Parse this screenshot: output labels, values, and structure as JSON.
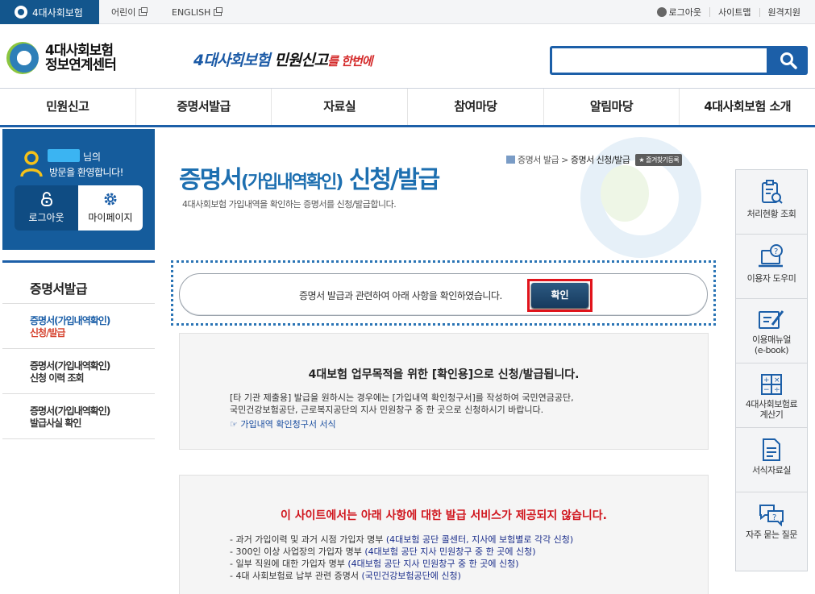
{
  "topbar": {
    "home_tab": "4대사회보험",
    "kids": "어린이",
    "english": "ENGLISH",
    "logout": "로그아웃",
    "sitemap": "사이트맵",
    "remote": "원격지원"
  },
  "header": {
    "brand_line1": "4대사회보험",
    "brand_line2": "정보연계센터",
    "slogan_a": "4대사회보험",
    "slogan_b": " 민원신고",
    "slogan_c": "를 한번에",
    "search_placeholder": ""
  },
  "gnb": [
    "민원신고",
    "증명서발급",
    "자료실",
    "참여마당",
    "알림마당",
    "4대사회보험 소개"
  ],
  "welcome": {
    "nim": "님의",
    "greeting": "방문을 환영합니다!",
    "logout_label": "로그아웃",
    "mypage_label": "마이페이지"
  },
  "lnb": {
    "title": "증명서발급",
    "items": [
      {
        "l1": "증명서(가입내역확인)",
        "l2": "신청/발급"
      },
      {
        "l1": "증명서(가입내역확인)",
        "l2": "신청 이력 조회"
      },
      {
        "l1": "증명서(가입내역확인)",
        "l2": "발급사실 확인"
      }
    ]
  },
  "breadcrumb": {
    "parent": "증명서 발급",
    "sep": ">",
    "current": "증명서 신청/발급",
    "fav": "즐겨찾기등록"
  },
  "page": {
    "title_main": "증명서",
    "title_sub": "(가입내역확인)",
    "title_end": " 신청/발급",
    "desc": "4대사회보험 가입내역을 확인하는 증명서를 신청/발급합니다."
  },
  "confirm": {
    "text": "증명서 발급과 관련하여 아래 사항을 확인하였습니다.",
    "button": "확인"
  },
  "info1": {
    "head": "4대보험 업무목적을 위한 [확인용]으로 신청/발급됩니다.",
    "line1": "[타 기관 제출용] 발급을 원하시는 경우에는 [가입내역 확인청구서]를 작성하여 국민연금공단,",
    "line2": "국민건강보험공단, 근로복지공단의 지사 민원창구 중 한 곳으로 신청하시기 바랍니다.",
    "link": "☞ 가입내역 확인청구서 서식"
  },
  "info2": {
    "head": "이 사이트에서는 아래 사항에 대한 발급 서비스가 제공되지 않습니다.",
    "items": [
      {
        "text": "- 과거 가입이력 및 과거 시점 가입자 명부 ",
        "hl": "(4대보험 공단 콜센터, 지사에 보험별로 각각 신청)"
      },
      {
        "text": "- 300인 이상 사업장의 가입자 명부 ",
        "hl": "(4대보험 공단 지사 민원창구 중 한 곳에 신청)"
      },
      {
        "text": "- 일부 직원에 대한 가입자 명부 ",
        "hl": "(4대보험 공단 지사 민원창구 중 한 곳에 신청)"
      },
      {
        "text": "- 4대 사회보험료 납부 관련 증명서 ",
        "hl": "(국민건강보험공단에 신청)"
      }
    ]
  },
  "quick": [
    {
      "icon": "clipboard-search-icon",
      "l1": "처리현황 조회",
      "l2": ""
    },
    {
      "icon": "laptop-help-icon",
      "l1": "이용자 도우미",
      "l2": ""
    },
    {
      "icon": "manual-pen-icon",
      "l1": "이용매뉴얼",
      "l2": "(e-book)"
    },
    {
      "icon": "calculator-icon",
      "l1": "4대사회보험료",
      "l2": "계산기"
    },
    {
      "icon": "document-list-icon",
      "l1": "서식자료실",
      "l2": ""
    },
    {
      "icon": "chat-question-icon",
      "l1": "자주 묻는 질문",
      "l2": ""
    }
  ],
  "colors": {
    "primary": "#1c5fa8",
    "accent_red": "#e1141c",
    "sidebar_blue": "#155c9c"
  }
}
